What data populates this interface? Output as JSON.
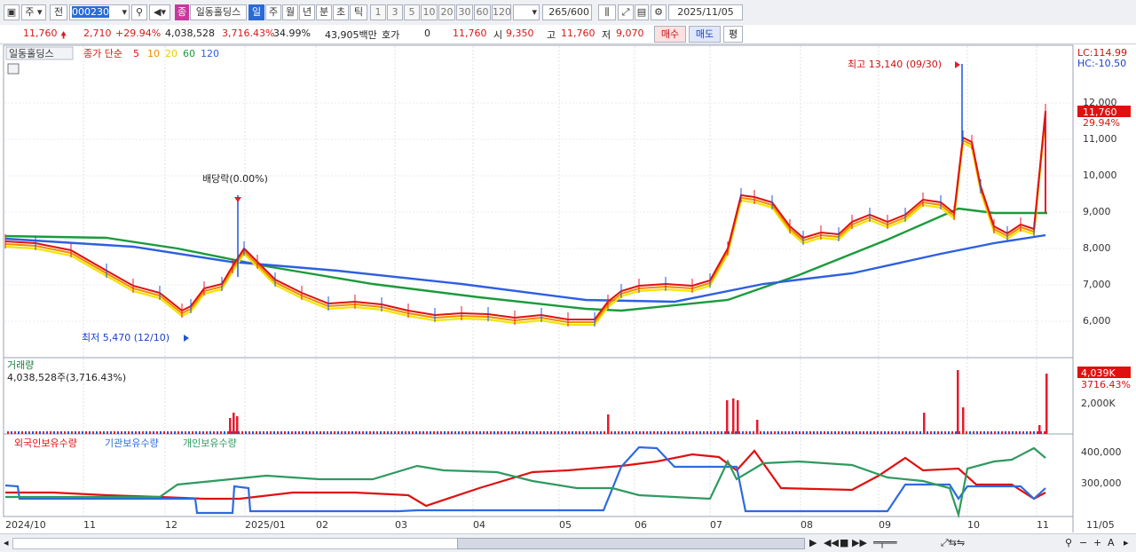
{
  "toolbar": {
    "type_label": "주",
    "prev_label": "전",
    "code": "000230",
    "stock_name": "일동홀딩스",
    "badge": "종",
    "periods": [
      "일",
      "주",
      "월",
      "년",
      "분",
      "초",
      "틱"
    ],
    "minutes": [
      "1",
      "3",
      "5",
      "10",
      "20",
      "30",
      "60",
      "120"
    ],
    "count": "265",
    "count_total": "/600",
    "date": "2025/11/05"
  },
  "quote": {
    "price": "11,760",
    "change": "2,710",
    "change_pct": "+29.94%",
    "volume": "4,038,528",
    "volume_pct": "3,716.43%",
    "turnover_pct": "34.99%",
    "amount": "43,905백만",
    "hoga_label": "호가",
    "hoga_value": "0",
    "hoga_price": "11,760",
    "open_label": "시",
    "open": "9,350",
    "high_label": "고",
    "high": "11,760",
    "low_label": "저",
    "low": "9,070",
    "buy_label": "매수",
    "sell_label": "매도",
    "eval_label": "평"
  },
  "legend": {
    "name": "일동홀딩스",
    "close_label": "종가 단순",
    "ma": [
      "5",
      "10",
      "20",
      "60",
      "120"
    ],
    "lc": "LC:114.99",
    "hc": "HC:-10.50",
    "high_note": "최고 13,140 (09/30)",
    "low_note": "최저 5,470 (12/10)",
    "dividend_note": "배당락(0.00%)",
    "last_price_tag": "11,760",
    "last_pct_tag": "29.94%"
  },
  "price_axis": [
    "12,000",
    "11,000",
    "10,000",
    "9,000",
    "8,000",
    "7,000",
    "6,000"
  ],
  "volume_panel": {
    "title": "거래량",
    "value": "4,038,528주(3,716.43%)",
    "tag": "4,039K",
    "tag_pct": "3716.43%",
    "axis": "2,000K"
  },
  "holding_panel": {
    "series": [
      "외국인보유수량",
      "기관보유수량",
      "개인보유수량"
    ],
    "axis": [
      "400,000",
      "300,000"
    ]
  },
  "date_axis": [
    "2024/10",
    "11",
    "12",
    "2025/01",
    "02",
    "03",
    "04",
    "05",
    "06",
    "07",
    "08",
    "09",
    "10",
    "11",
    "11/05"
  ],
  "colors": {
    "up": "#e8192c",
    "down": "#1f55d6",
    "ma5": "#e01010",
    "ma10": "#f08c00",
    "ma20": "#f2e400",
    "ma60": "#1a9b3b",
    "ma120": "#2d5fe0",
    "foreign": "#e01010",
    "inst": "#2d6be0",
    "retail": "#2e9a5f"
  }
}
